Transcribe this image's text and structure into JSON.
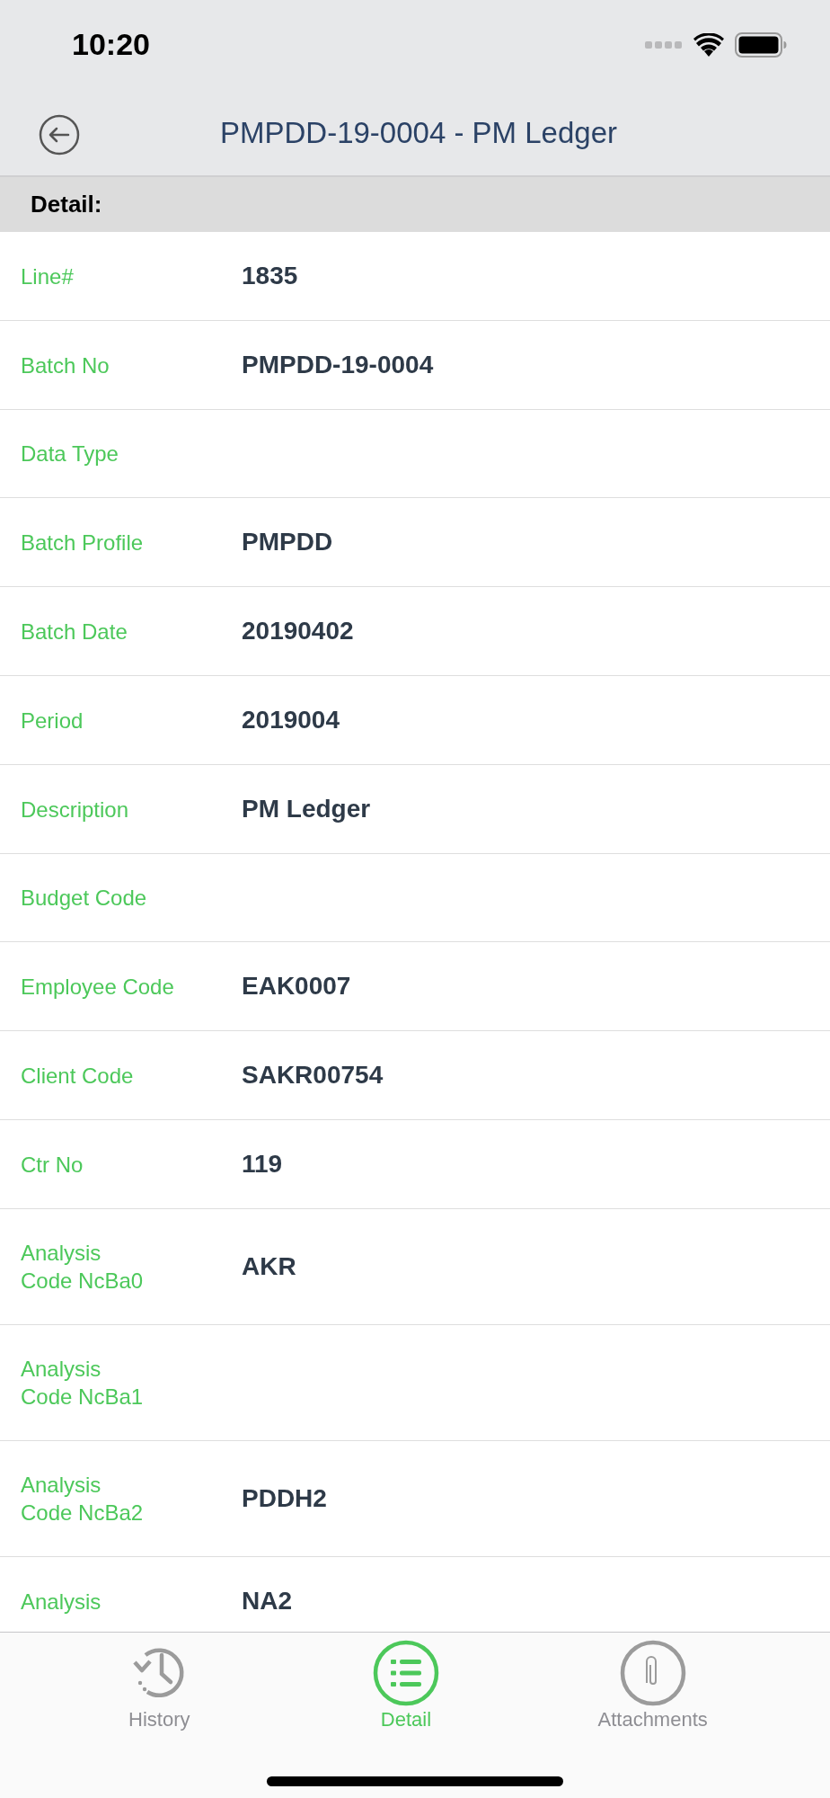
{
  "status_bar": {
    "time": "10:20"
  },
  "nav": {
    "title": "PMPDD-19-0004 - PM Ledger"
  },
  "section": {
    "title": "Detail:"
  },
  "rows": [
    {
      "label": "Line#",
      "value": "1835"
    },
    {
      "label": "Batch No",
      "value": "PMPDD-19-0004"
    },
    {
      "label": "Data Type"
    },
    {
      "label": "Batch Profile",
      "value": "PMPDD"
    },
    {
      "label": "Batch Date",
      "value": "20190402"
    },
    {
      "label": "Period",
      "value": "2019004"
    },
    {
      "label": "Description",
      "value": "PM Ledger"
    },
    {
      "label": "Budget Code"
    },
    {
      "label": "Employee Code",
      "value": "EAK0007"
    },
    {
      "label": "Client Code",
      "value": "SAKR00754"
    },
    {
      "label": "Ctr No",
      "value": "119"
    },
    {
      "label": "Analysis Code NcBa0",
      "value": "AKR"
    },
    {
      "label": "Analysis Code NcBa1"
    },
    {
      "label": "Analysis Code NcBa2",
      "value": "PDDH2"
    },
    {
      "label": "Analysis",
      "value": "NA2"
    }
  ],
  "tabs": [
    {
      "kind": "history",
      "label": "History",
      "selected": false
    },
    {
      "kind": "detail",
      "label": "Detail",
      "selected": true
    },
    {
      "kind": "attachments",
      "label": "Attachments",
      "selected": false
    }
  ]
}
